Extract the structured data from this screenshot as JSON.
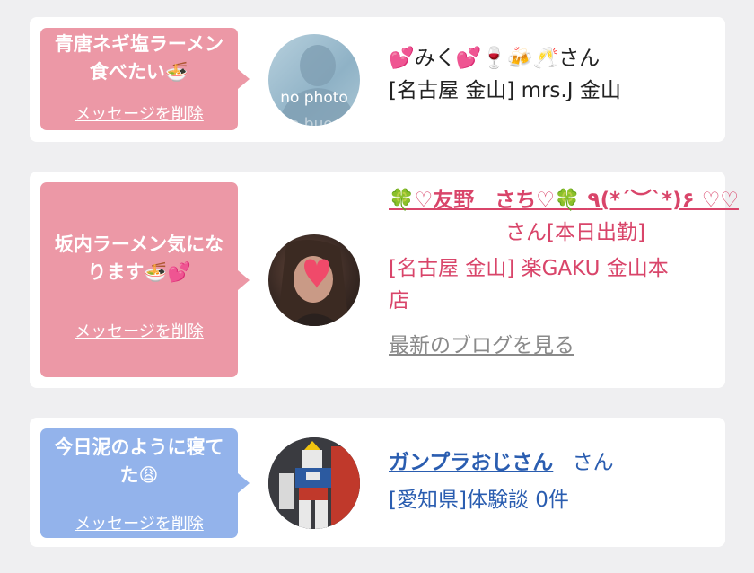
{
  "messages": [
    {
      "status": "青唐ネギ塩ラーメン食べたい🍜",
      "delete_label": "メッセージを削除",
      "avatar_text": "no photo",
      "name": "💕みく💕🍷🍻🥂さん",
      "area": "[名古屋 金山] mrs.J 金山"
    },
    {
      "status": "坂内ラーメン気になります🍜💕",
      "delete_label": "メッセージを削除",
      "name": "🍀♡友野　さち♡🍀 ٩(*´︶`*)۶ ♡♡",
      "name_suffix": "さん[本日出勤]",
      "area_line1": "[名古屋 金山] 楽GAKU 金山本",
      "area_line2": "店",
      "blog_link": "最新のブログを見る"
    },
    {
      "status": "今日泥のように寝てた😩",
      "delete_label": "メッセージを削除",
      "name": "ガンプラおじさん",
      "name_suffix": "さん",
      "area": "[愛知県]体験談 0件"
    }
  ],
  "colors": {
    "pink_bubble": "#ec98a6",
    "blue_bubble": "#93b3eb",
    "cast_text": "#d9456a",
    "user_text": "#2a5db0",
    "background": "#efeff1"
  }
}
